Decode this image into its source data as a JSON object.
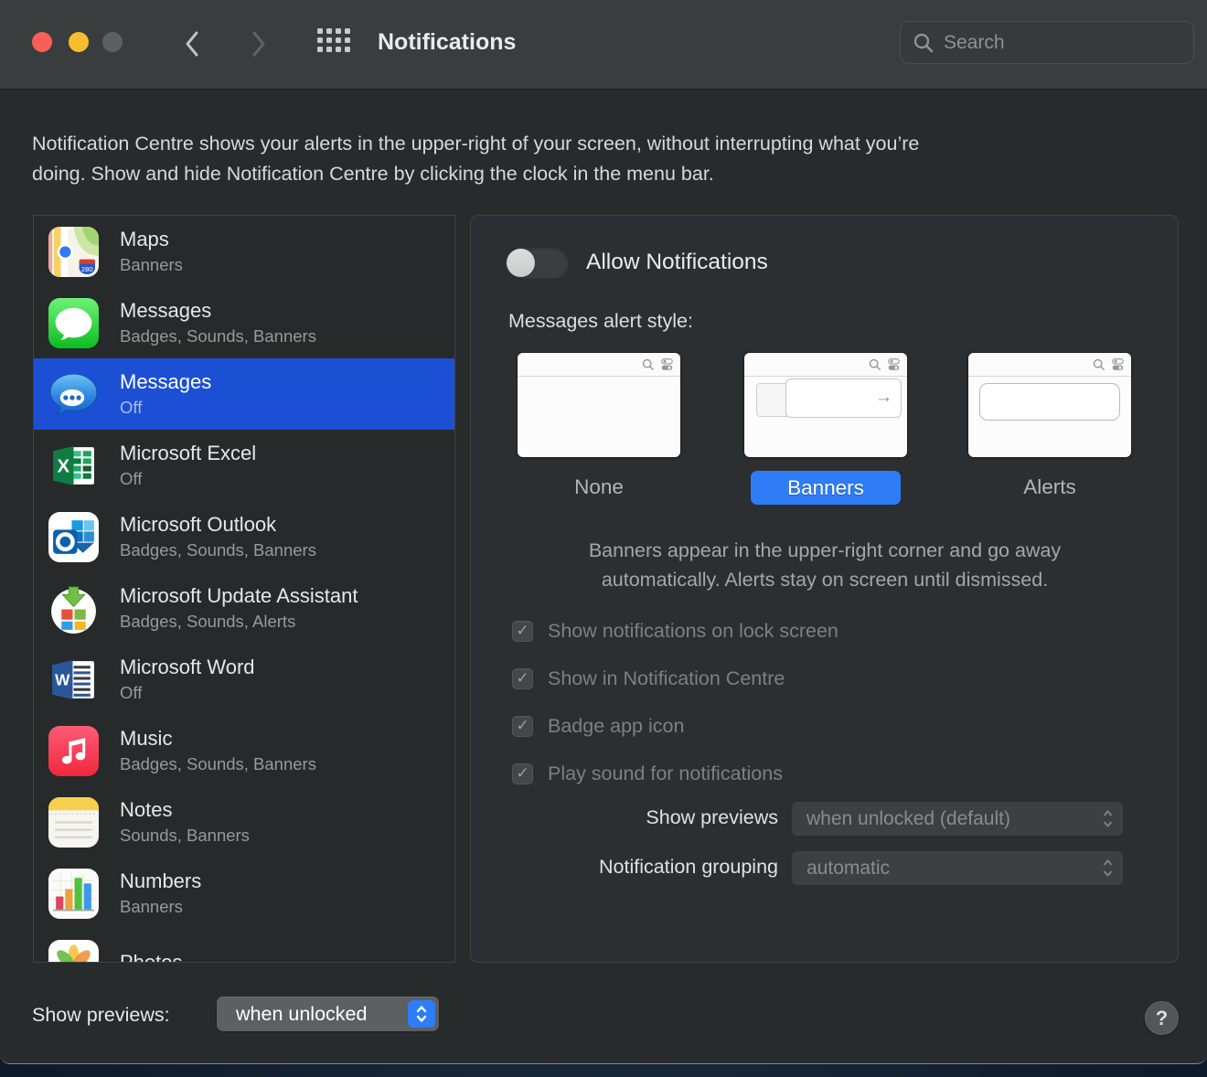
{
  "titlebar": {
    "title": "Notifications",
    "search_placeholder": "Search"
  },
  "intro": "Notification Centre shows your alerts in the upper-right of your screen, without interrupting what you’re\ndoing. Show and hide Notification Centre by clicking the clock in the menu bar.",
  "sidebar": {
    "items": [
      {
        "name": "Maps",
        "detail": "Banners",
        "icon": "maps",
        "selected": false
      },
      {
        "name": "Messages",
        "detail": "Badges, Sounds, Banners",
        "icon": "messages-green",
        "selected": false
      },
      {
        "name": "Messages",
        "detail": "Off",
        "icon": "messages-blue",
        "selected": true
      },
      {
        "name": "Microsoft Excel",
        "detail": "Off",
        "icon": "excel",
        "selected": false
      },
      {
        "name": "Microsoft Outlook",
        "detail": "Badges, Sounds, Banners",
        "icon": "outlook",
        "selected": false
      },
      {
        "name": "Microsoft Update Assistant",
        "detail": "Badges, Sounds, Alerts",
        "icon": "ms-update",
        "selected": false
      },
      {
        "name": "Microsoft Word",
        "detail": "Off",
        "icon": "word",
        "selected": false
      },
      {
        "name": "Music",
        "detail": "Badges, Sounds, Banners",
        "icon": "music",
        "selected": false
      },
      {
        "name": "Notes",
        "detail": "Sounds, Banners",
        "icon": "notes",
        "selected": false
      },
      {
        "name": "Numbers",
        "detail": "Banners",
        "icon": "numbers",
        "selected": false
      },
      {
        "name": "Photos",
        "detail": "",
        "icon": "photos",
        "selected": false
      }
    ]
  },
  "panel": {
    "allow_notifications_label": "Allow Notifications",
    "allow_notifications_on": false,
    "alert_style_label": "Messages alert style:",
    "alert_styles": [
      {
        "label": "None",
        "selected": false
      },
      {
        "label": "Banners",
        "selected": true
      },
      {
        "label": "Alerts",
        "selected": false
      }
    ],
    "style_description": "Banners appear in the upper-right corner and go away\nautomatically. Alerts stay on screen until dismissed.",
    "options": [
      {
        "label": "Show notifications on lock screen",
        "checked": true,
        "enabled": false
      },
      {
        "label": "Show in Notification Centre",
        "checked": true,
        "enabled": false
      },
      {
        "label": "Badge app icon",
        "checked": true,
        "enabled": false
      },
      {
        "label": "Play sound for notifications",
        "checked": true,
        "enabled": false
      }
    ],
    "show_previews": {
      "label": "Show previews",
      "value": "when unlocked (default)"
    },
    "notification_grouping": {
      "label": "Notification grouping",
      "value": "automatic"
    }
  },
  "footer": {
    "show_previews_label": "Show previews:",
    "show_previews_value": "when unlocked",
    "help": "?"
  },
  "colors": {
    "selection_blue": "#1c50d4",
    "accent_blue": "#2e7cf6",
    "titlebar_bg": "#393d3e",
    "window_bg": "#272b2c",
    "panel_bg": "#2c2f31"
  }
}
